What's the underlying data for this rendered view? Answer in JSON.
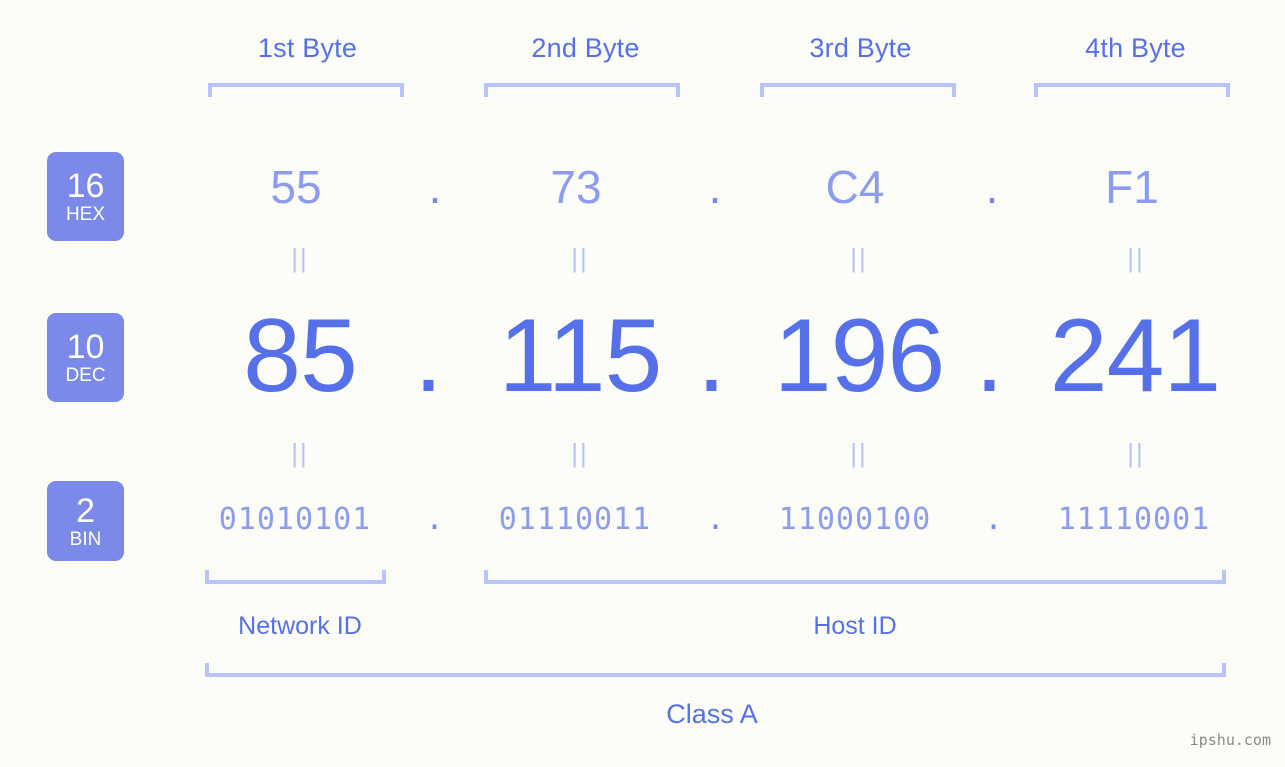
{
  "bytes": [
    {
      "header": "1st Byte"
    },
    {
      "header": "2nd Byte"
    },
    {
      "header": "3rd Byte"
    },
    {
      "header": "4th Byte"
    }
  ],
  "bases": {
    "hex": {
      "number": "16",
      "name": "HEX"
    },
    "dec": {
      "number": "10",
      "name": "DEC"
    },
    "bin": {
      "number": "2",
      "name": "BIN"
    }
  },
  "rows": {
    "hex": [
      "55",
      "73",
      "C4",
      "F1"
    ],
    "dec": [
      "85",
      "115",
      "196",
      "241"
    ],
    "bin": [
      "01010101",
      "01110011",
      "11000100",
      "11110001"
    ]
  },
  "separator": ".",
  "equals": "||",
  "sections": {
    "network_id": "Network ID",
    "host_id": "Host ID",
    "class": "Class A"
  },
  "watermark": "ipshu.com",
  "colors": {
    "background": "#fcfdf8",
    "badge_bg": "#7b8ae8",
    "badge_text": "#ffffff",
    "accent_strong": "#5670ea",
    "accent_light": "#8c9cf0",
    "bracket": "#b9c3f7",
    "watermark": "#8a8a8a"
  }
}
